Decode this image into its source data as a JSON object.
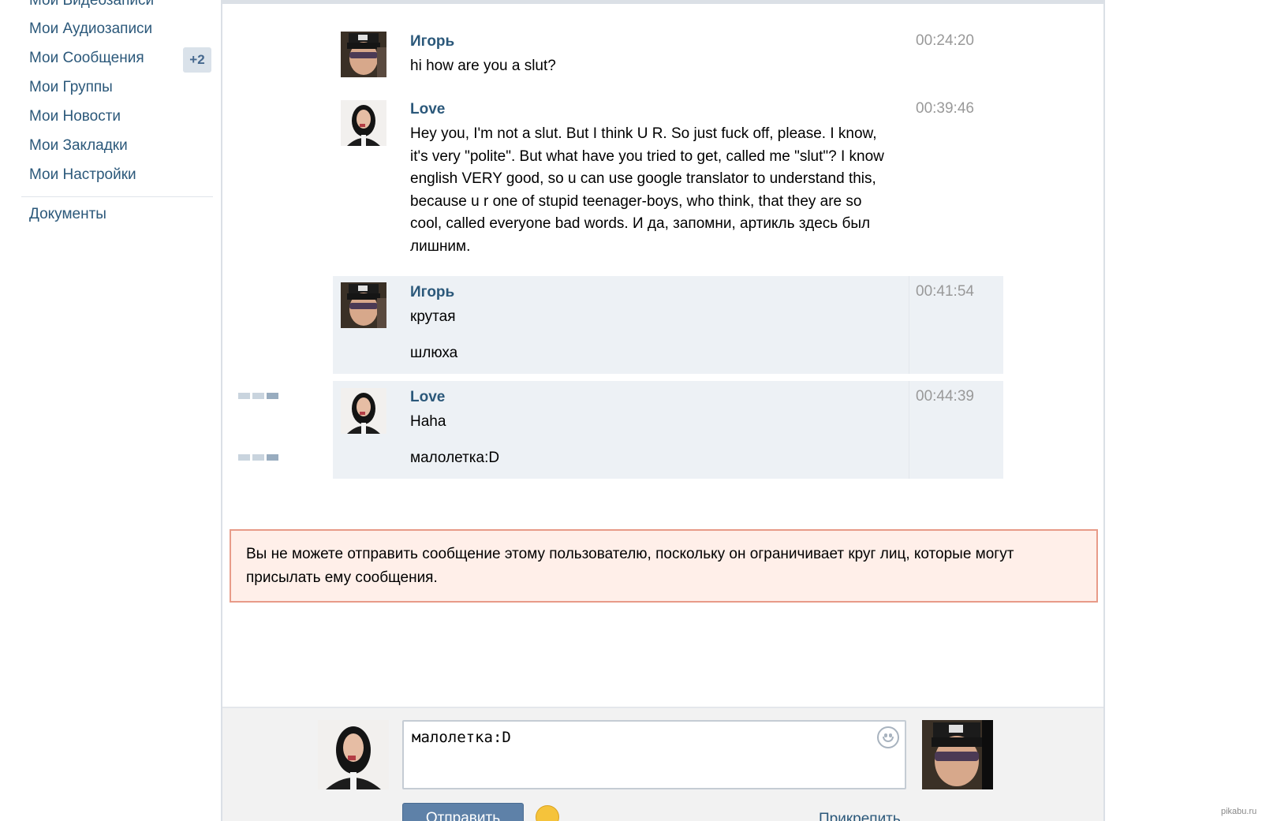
{
  "sidebar": {
    "items": [
      {
        "label": "Мои Видеозаписи"
      },
      {
        "label": "Мои Аудиозаписи"
      },
      {
        "label": "Мои Сообщения",
        "badge": "+2"
      },
      {
        "label": "Мои Группы"
      },
      {
        "label": "Мои Новости"
      },
      {
        "label": "Мои Закладки"
      },
      {
        "label": "Мои Настройки"
      }
    ],
    "documents_label": "Документы"
  },
  "messages": [
    {
      "author": "Игорь",
      "time": "00:24:20",
      "lines": [
        "hi how are you a slut?"
      ]
    },
    {
      "author": "Love",
      "time": "00:39:46",
      "lines": [
        "Hey you, I'm not a slut. But I think U R. So just fuck off, please. I know,",
        "it's very \"polite\". But what have you tried to get, called me \"slut\"? I know",
        "english VERY good, so u can use google translator to understand this,",
        "because u r one of stupid teenager-boys, who think, that they are so",
        "cool, called everyone bad words. И да, запомни, артикль здесь был",
        "лишним."
      ]
    },
    {
      "author": "Игорь",
      "time": "00:41:54",
      "lines": [
        "крутая"
      ],
      "followup": "шлюха"
    },
    {
      "author": "Love",
      "time": "00:44:39",
      "lines": [
        "Haha"
      ],
      "followup": "малолетка:D"
    }
  ],
  "error": {
    "text": "Вы не можете отправить сообщение этому пользователю, поскольку он ограничивает круг лиц, которые могут присылать ему сообщения."
  },
  "composer": {
    "value": "малолетка:D",
    "send_label": "Отправить",
    "attach_label": "Прикрепить"
  },
  "watermark": "pikabu.ru",
  "colors": {
    "link": "#2b587a",
    "unread_bg": "#edf1f5",
    "error_bg": "#ffefe9",
    "error_border": "#e89b88",
    "send_button": "#5e81a8"
  }
}
